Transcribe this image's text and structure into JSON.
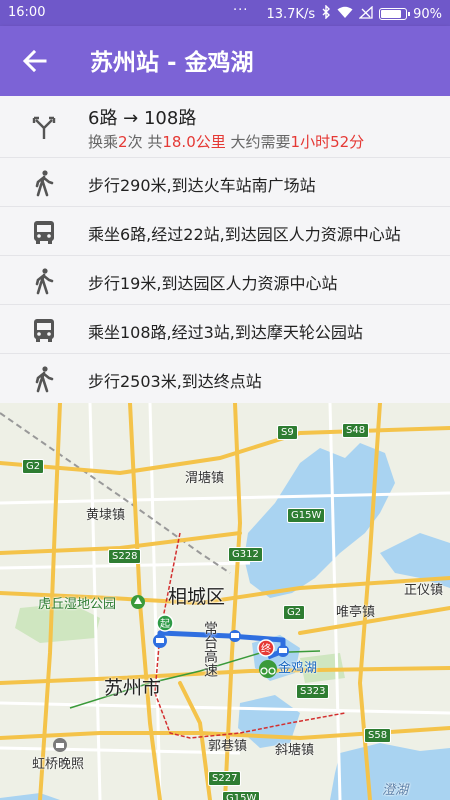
{
  "status_bar": {
    "time": "16:00",
    "dots": "···",
    "speed": "13.7K/s",
    "battery": "90%",
    "battery_level": 0.9
  },
  "app_bar": {
    "title": "苏州站 - 金鸡湖"
  },
  "route": {
    "summary_title": "6路 → 108路",
    "transfer_prefix": "换乘",
    "transfer_count": "2",
    "transfer_suffix": "次 共",
    "distance": "18.0公里",
    "duration_prefix": " 大约需要",
    "duration": "1小时52分"
  },
  "steps": [
    {
      "type": "walk",
      "icon": "walk-icon",
      "text": "步行290米,到达火车站南广场站"
    },
    {
      "type": "bus",
      "icon": "bus-icon",
      "text": "乘坐6路,经过22站,到达园区人力资源中心站"
    },
    {
      "type": "walk",
      "icon": "walk-icon",
      "text": "步行19米,到达园区人力资源中心站"
    },
    {
      "type": "bus",
      "icon": "bus-icon",
      "text": "乘坐108路,经过3站,到达摩天轮公园站"
    },
    {
      "type": "walk",
      "icon": "walk-icon",
      "text": "步行2503米,到达终点站"
    }
  ],
  "map": {
    "places": {
      "weitang": "渭塘镇",
      "huangdai": "黄埭镇",
      "xiangcheng": "相城区",
      "huqiu": "虎丘湿地公园",
      "suzhou": "苏州市",
      "jinjihu": "金鸡湖",
      "weiting": "唯亭镇",
      "zhengyi": "正仪镇",
      "guoxiang": "郭巷镇",
      "xietang": "斜塘镇",
      "hongqiao": "虹桥晚照",
      "changtai": "常台高速",
      "chenghu": "澄湖"
    },
    "shields": {
      "g2_left": "G2",
      "s9": "S9",
      "s48": "S48",
      "g15w": "G15W",
      "s228": "S228",
      "g312": "G312",
      "g2_mid": "G2",
      "s323": "S323",
      "s58": "S58",
      "s227": "S227",
      "g15w_bottom": "G15W"
    },
    "start_marker": "起",
    "end_marker": "终"
  }
}
